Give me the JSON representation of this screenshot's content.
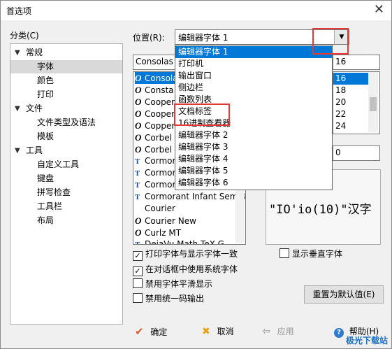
{
  "window": {
    "title": "首选项",
    "close_glyph": "✕"
  },
  "category": {
    "label": "分类(C)"
  },
  "tree": [
    {
      "label": "常规",
      "level": 0,
      "expander": "▼"
    },
    {
      "label": "字体",
      "level": 1,
      "selected": true
    },
    {
      "label": "颜色",
      "level": 1
    },
    {
      "label": "打印",
      "level": 1
    },
    {
      "label": "文件",
      "level": 0,
      "expander": "▼"
    },
    {
      "label": "文件类型及语法",
      "level": 1
    },
    {
      "label": "模板",
      "level": 1
    },
    {
      "label": "工具",
      "level": 0,
      "expander": "▼"
    },
    {
      "label": "自定义工具",
      "level": 1
    },
    {
      "label": "键盘",
      "level": 1
    },
    {
      "label": "拼写检查",
      "level": 1
    },
    {
      "label": "工具栏",
      "level": 1
    },
    {
      "label": "布局",
      "level": 1
    }
  ],
  "position": {
    "label": "位置(R):",
    "selected": "编辑器字体 1",
    "arrow": "▼"
  },
  "popup_options": [
    "编辑器字体 1",
    "打印机",
    "输出窗口",
    "侧边栏",
    "函数列表",
    "文档标签",
    "16进制查看器",
    "编辑器字体 2",
    "编辑器字体 3",
    "编辑器字体 4",
    "编辑器字体 5",
    "编辑器字体 6"
  ],
  "font": {
    "value": "Consolas",
    "list": [
      {
        "name": "Consola",
        "icon": "O",
        "selected": true
      },
      {
        "name": "Consta",
        "icon": "O"
      },
      {
        "name": "Cooper",
        "icon": "O"
      },
      {
        "name": "Cooper",
        "icon": "O"
      },
      {
        "name": "Copper",
        "icon": "O"
      },
      {
        "name": "Corbel",
        "icon": "O"
      },
      {
        "name": "Corbel",
        "icon": "O"
      },
      {
        "name": "Cormor",
        "icon": "T"
      },
      {
        "name": "Cormor",
        "icon": "T"
      },
      {
        "name": "Cormor",
        "icon": "T"
      },
      {
        "name": "Cormorant Infant SemiB",
        "icon": "T"
      },
      {
        "name": "Courier",
        "icon": ""
      },
      {
        "name": "Courier New",
        "icon": "O"
      },
      {
        "name": "Curlz MT",
        "icon": "O"
      },
      {
        "name": "DejaVu Math TeX G",
        "icon": "T"
      }
    ]
  },
  "size": {
    "value": "16",
    "list": [
      "16",
      "18",
      "20",
      "22",
      "24"
    ],
    "selected": "16",
    "style_value": "0"
  },
  "preview": {
    "text": "\"IO'io(10)\"汉字"
  },
  "checkboxes": [
    {
      "label": "打印字体与显示字体一致",
      "checked": true,
      "mark": "✓"
    },
    {
      "label": "在对话框中使用系统字体",
      "checked": true,
      "mark": "✓"
    },
    {
      "label": "禁用字体平滑显示",
      "checked": false,
      "mark": ""
    },
    {
      "label": "禁用统一码输出",
      "checked": false,
      "mark": ""
    },
    {
      "label": "显示垂直字体",
      "checked": false,
      "mark": ""
    }
  ],
  "buttons": {
    "reset": "重置为默认值(E)",
    "ok": "确定",
    "ok_icon": "✔",
    "cancel": "取消",
    "cancel_icon": "✖",
    "apply": "应用",
    "apply_icon": "⇦",
    "help": "帮助(H)",
    "help_icon": "?"
  },
  "watermark": "极光下载站",
  "colors": {
    "highlight": "#0078d7",
    "annotation": "#e53935"
  }
}
